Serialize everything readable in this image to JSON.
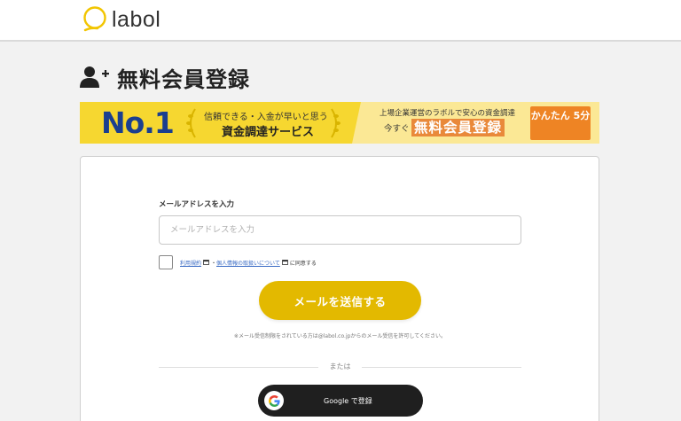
{
  "header": {
    "logo_text": "labol",
    "logo_icon": "speech-bubble-logo"
  },
  "page": {
    "title": "無料会員登録",
    "title_icon": "user-add-icon"
  },
  "banner": {
    "no1": "No.1",
    "tagline_small": "信頼できる・入金が早いと思う",
    "tagline_main": "資金調達サービス",
    "right_small": "上場企業運営のラボルで安心の資金調達",
    "right_prefix": "今すぐ",
    "right_highlight": "無料会員登録",
    "cta": "かんたん 5分",
    "colors": {
      "yellow": "#f6d730",
      "navy": "#1a3f8f",
      "orange": "#ee8424"
    }
  },
  "form": {
    "email_label": "メールアドレスを入力",
    "email_placeholder": "メールアドレスを入力",
    "email_value": "",
    "terms_link": "利用規約",
    "separator": "・",
    "privacy_link": "個人情報の取扱いについて",
    "agree_suffix": "に同意する",
    "checkbox_checked": false,
    "send_button": "メールを送信する",
    "note": "※メール受信制限をされている方は@labol.co.jpからのメール受信を許可してください。",
    "or_text": "または",
    "google_button": "Google で登録",
    "accent_color": "#e3b900"
  }
}
